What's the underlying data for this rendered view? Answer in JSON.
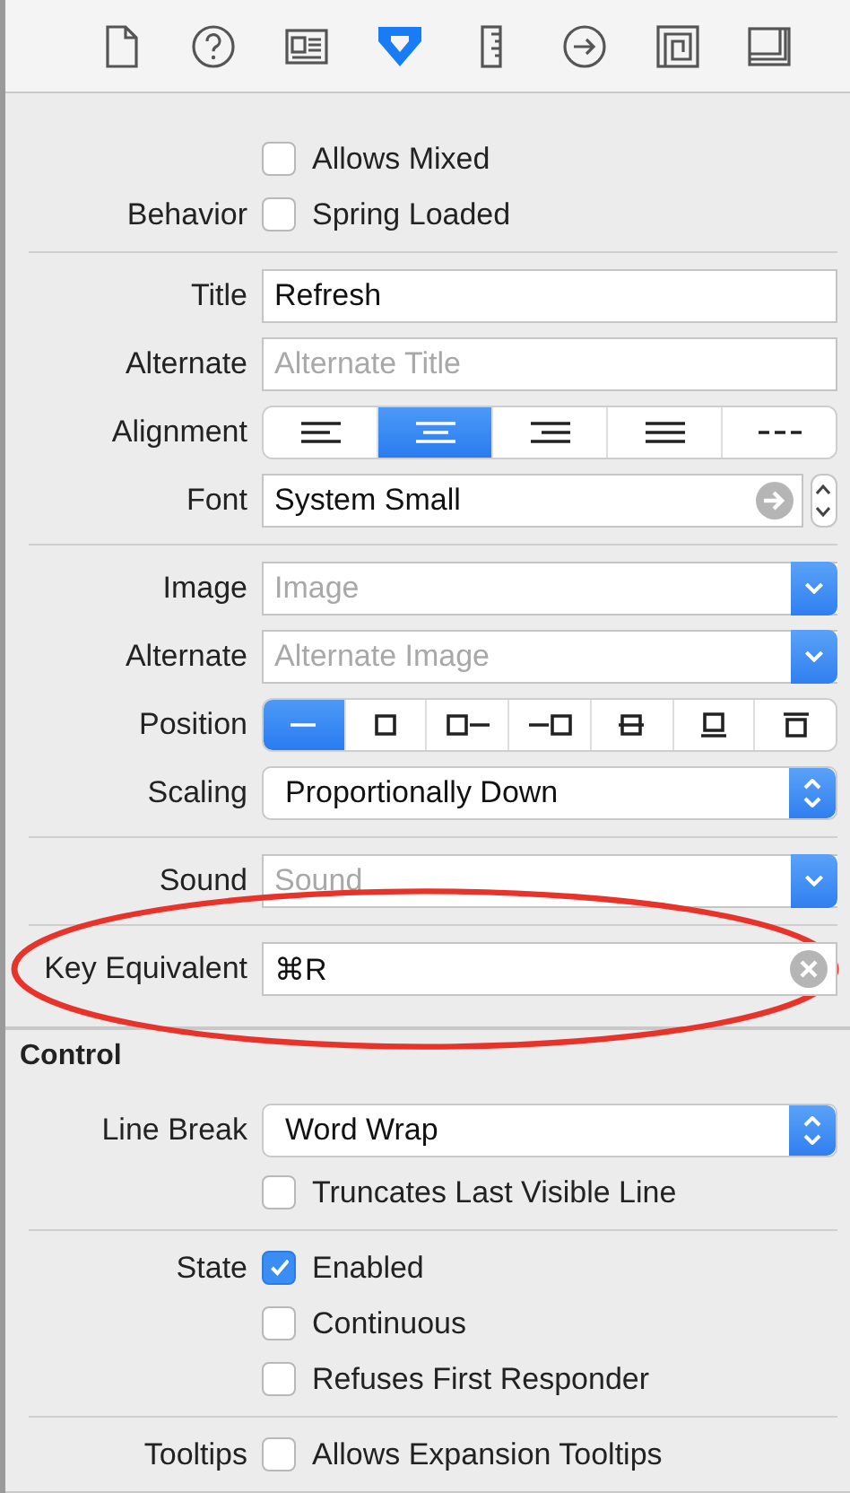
{
  "toolbar": {
    "tabs": [
      {
        "selected": false
      },
      {
        "selected": false
      },
      {
        "selected": false
      },
      {
        "selected": true
      },
      {
        "selected": false
      },
      {
        "selected": false
      },
      {
        "selected": false
      },
      {
        "selected": false
      }
    ]
  },
  "sections": [
    {
      "groups": [
        {
          "rows": [
            {
              "kind": "checkbox",
              "text": "Allows Mixed",
              "checked": false
            },
            {
              "kind": "checkbox",
              "label": "Behavior",
              "text": "Spring Loaded",
              "checked": false
            }
          ]
        },
        {
          "rows": [
            {
              "kind": "text",
              "label": "Title",
              "value": "Refresh"
            },
            {
              "kind": "text",
              "label": "Alternate",
              "placeholder": "Alternate Title"
            },
            {
              "kind": "alignment",
              "label": "Alignment",
              "segments": [
                {
                  "selected": false
                },
                {
                  "selected": true
                },
                {
                  "selected": false
                },
                {
                  "selected": false
                },
                {
                  "selected": false
                }
              ]
            },
            {
              "kind": "font",
              "label": "Font",
              "value": "System Small"
            }
          ]
        },
        {
          "rows": [
            {
              "kind": "combo",
              "label": "Image",
              "placeholder": "Image"
            },
            {
              "kind": "combo",
              "label": "Alternate",
              "placeholder": "Alternate Image"
            },
            {
              "kind": "position",
              "label": "Position",
              "segments": [
                {
                  "selected": true
                },
                {
                  "selected": false
                },
                {
                  "selected": false
                },
                {
                  "selected": false
                },
                {
                  "selected": false
                },
                {
                  "selected": false
                },
                {
                  "selected": false
                }
              ]
            },
            {
              "kind": "popup",
              "label": "Scaling",
              "value": "Proportionally Down"
            }
          ]
        },
        {
          "rows": [
            {
              "kind": "combo",
              "label": "Sound",
              "placeholder": "Sound"
            }
          ]
        },
        {
          "highlighted": true,
          "rows": [
            {
              "kind": "key",
              "label": "Key Equivalent",
              "value": "⌘R"
            }
          ]
        }
      ]
    },
    {
      "title": "Control",
      "groups": [
        {
          "rows": [
            {
              "kind": "popup",
              "label": "Line Break",
              "value": "Word Wrap"
            },
            {
              "kind": "checkbox",
              "text": "Truncates Last Visible Line",
              "checked": false
            }
          ]
        },
        {
          "rows": [
            {
              "kind": "checkbox",
              "label": "State",
              "text": "Enabled",
              "checked": true
            },
            {
              "kind": "checkbox",
              "text": "Continuous",
              "checked": false
            },
            {
              "kind": "checkbox",
              "text": "Refuses First Responder",
              "checked": false
            }
          ]
        },
        {
          "rows": [
            {
              "kind": "checkbox",
              "label": "Tooltips",
              "text": "Allows Expansion Tooltips",
              "checked": false
            }
          ]
        }
      ]
    }
  ]
}
